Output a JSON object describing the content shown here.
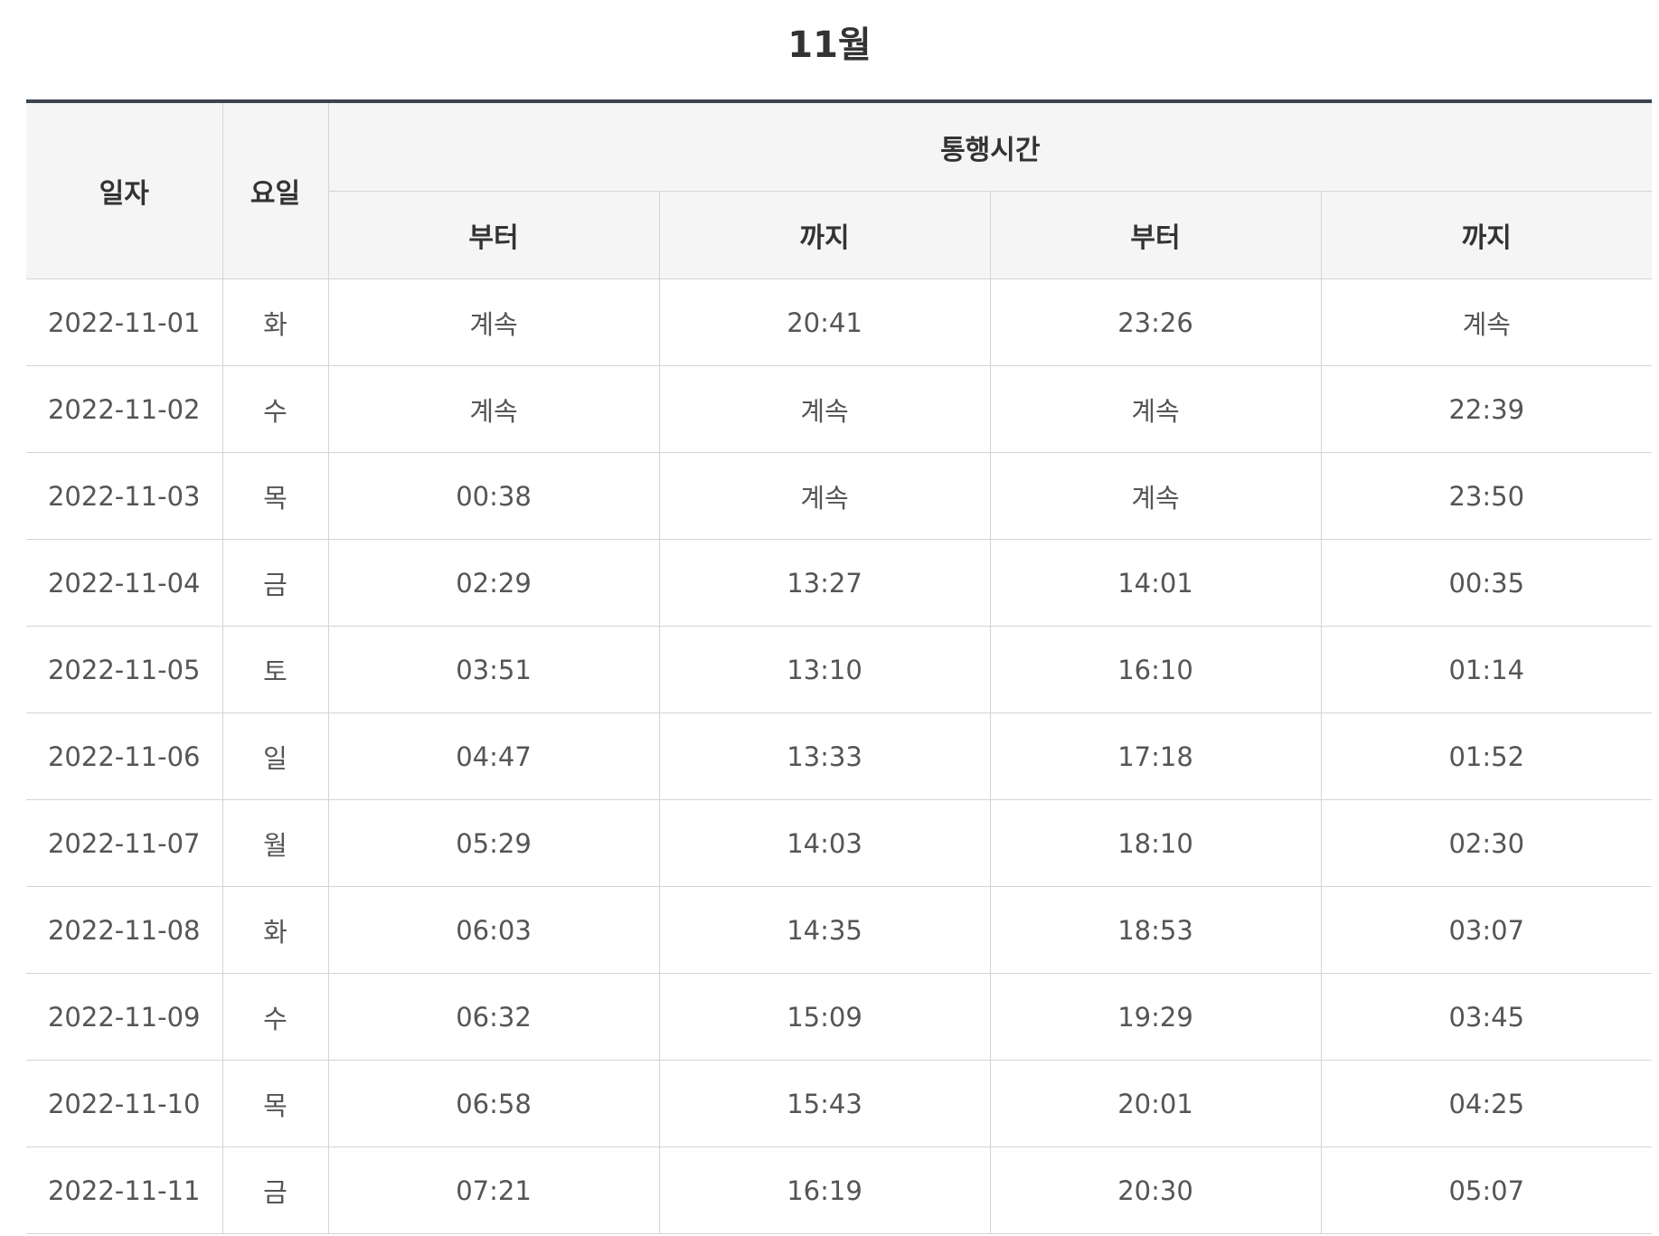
{
  "title": "11월",
  "table": {
    "headers": {
      "date": "일자",
      "day": "요일",
      "passage": "통행시간",
      "from1": "부터",
      "to1": "까지",
      "from2": "부터",
      "to2": "까지"
    },
    "rows": [
      {
        "date": "2022-11-01",
        "day": "화",
        "from1": "계속",
        "to1": "20:41",
        "from2": "23:26",
        "to2": "계속"
      },
      {
        "date": "2022-11-02",
        "day": "수",
        "from1": "계속",
        "to1": "계속",
        "from2": "계속",
        "to2": "22:39"
      },
      {
        "date": "2022-11-03",
        "day": "목",
        "from1": "00:38",
        "to1": "계속",
        "from2": "계속",
        "to2": "23:50"
      },
      {
        "date": "2022-11-04",
        "day": "금",
        "from1": "02:29",
        "to1": "13:27",
        "from2": "14:01",
        "to2": "00:35"
      },
      {
        "date": "2022-11-05",
        "day": "토",
        "from1": "03:51",
        "to1": "13:10",
        "from2": "16:10",
        "to2": "01:14"
      },
      {
        "date": "2022-11-06",
        "day": "일",
        "from1": "04:47",
        "to1": "13:33",
        "from2": "17:18",
        "to2": "01:52"
      },
      {
        "date": "2022-11-07",
        "day": "월",
        "from1": "05:29",
        "to1": "14:03",
        "from2": "18:10",
        "to2": "02:30"
      },
      {
        "date": "2022-11-08",
        "day": "화",
        "from1": "06:03",
        "to1": "14:35",
        "from2": "18:53",
        "to2": "03:07"
      },
      {
        "date": "2022-11-09",
        "day": "수",
        "from1": "06:32",
        "to1": "15:09",
        "from2": "19:29",
        "to2": "03:45"
      },
      {
        "date": "2022-11-10",
        "day": "목",
        "from1": "06:58",
        "to1": "15:43",
        "from2": "20:01",
        "to2": "04:25"
      },
      {
        "date": "2022-11-11",
        "day": "금",
        "from1": "07:21",
        "to1": "16:19",
        "from2": "20:30",
        "to2": "05:07"
      }
    ]
  }
}
